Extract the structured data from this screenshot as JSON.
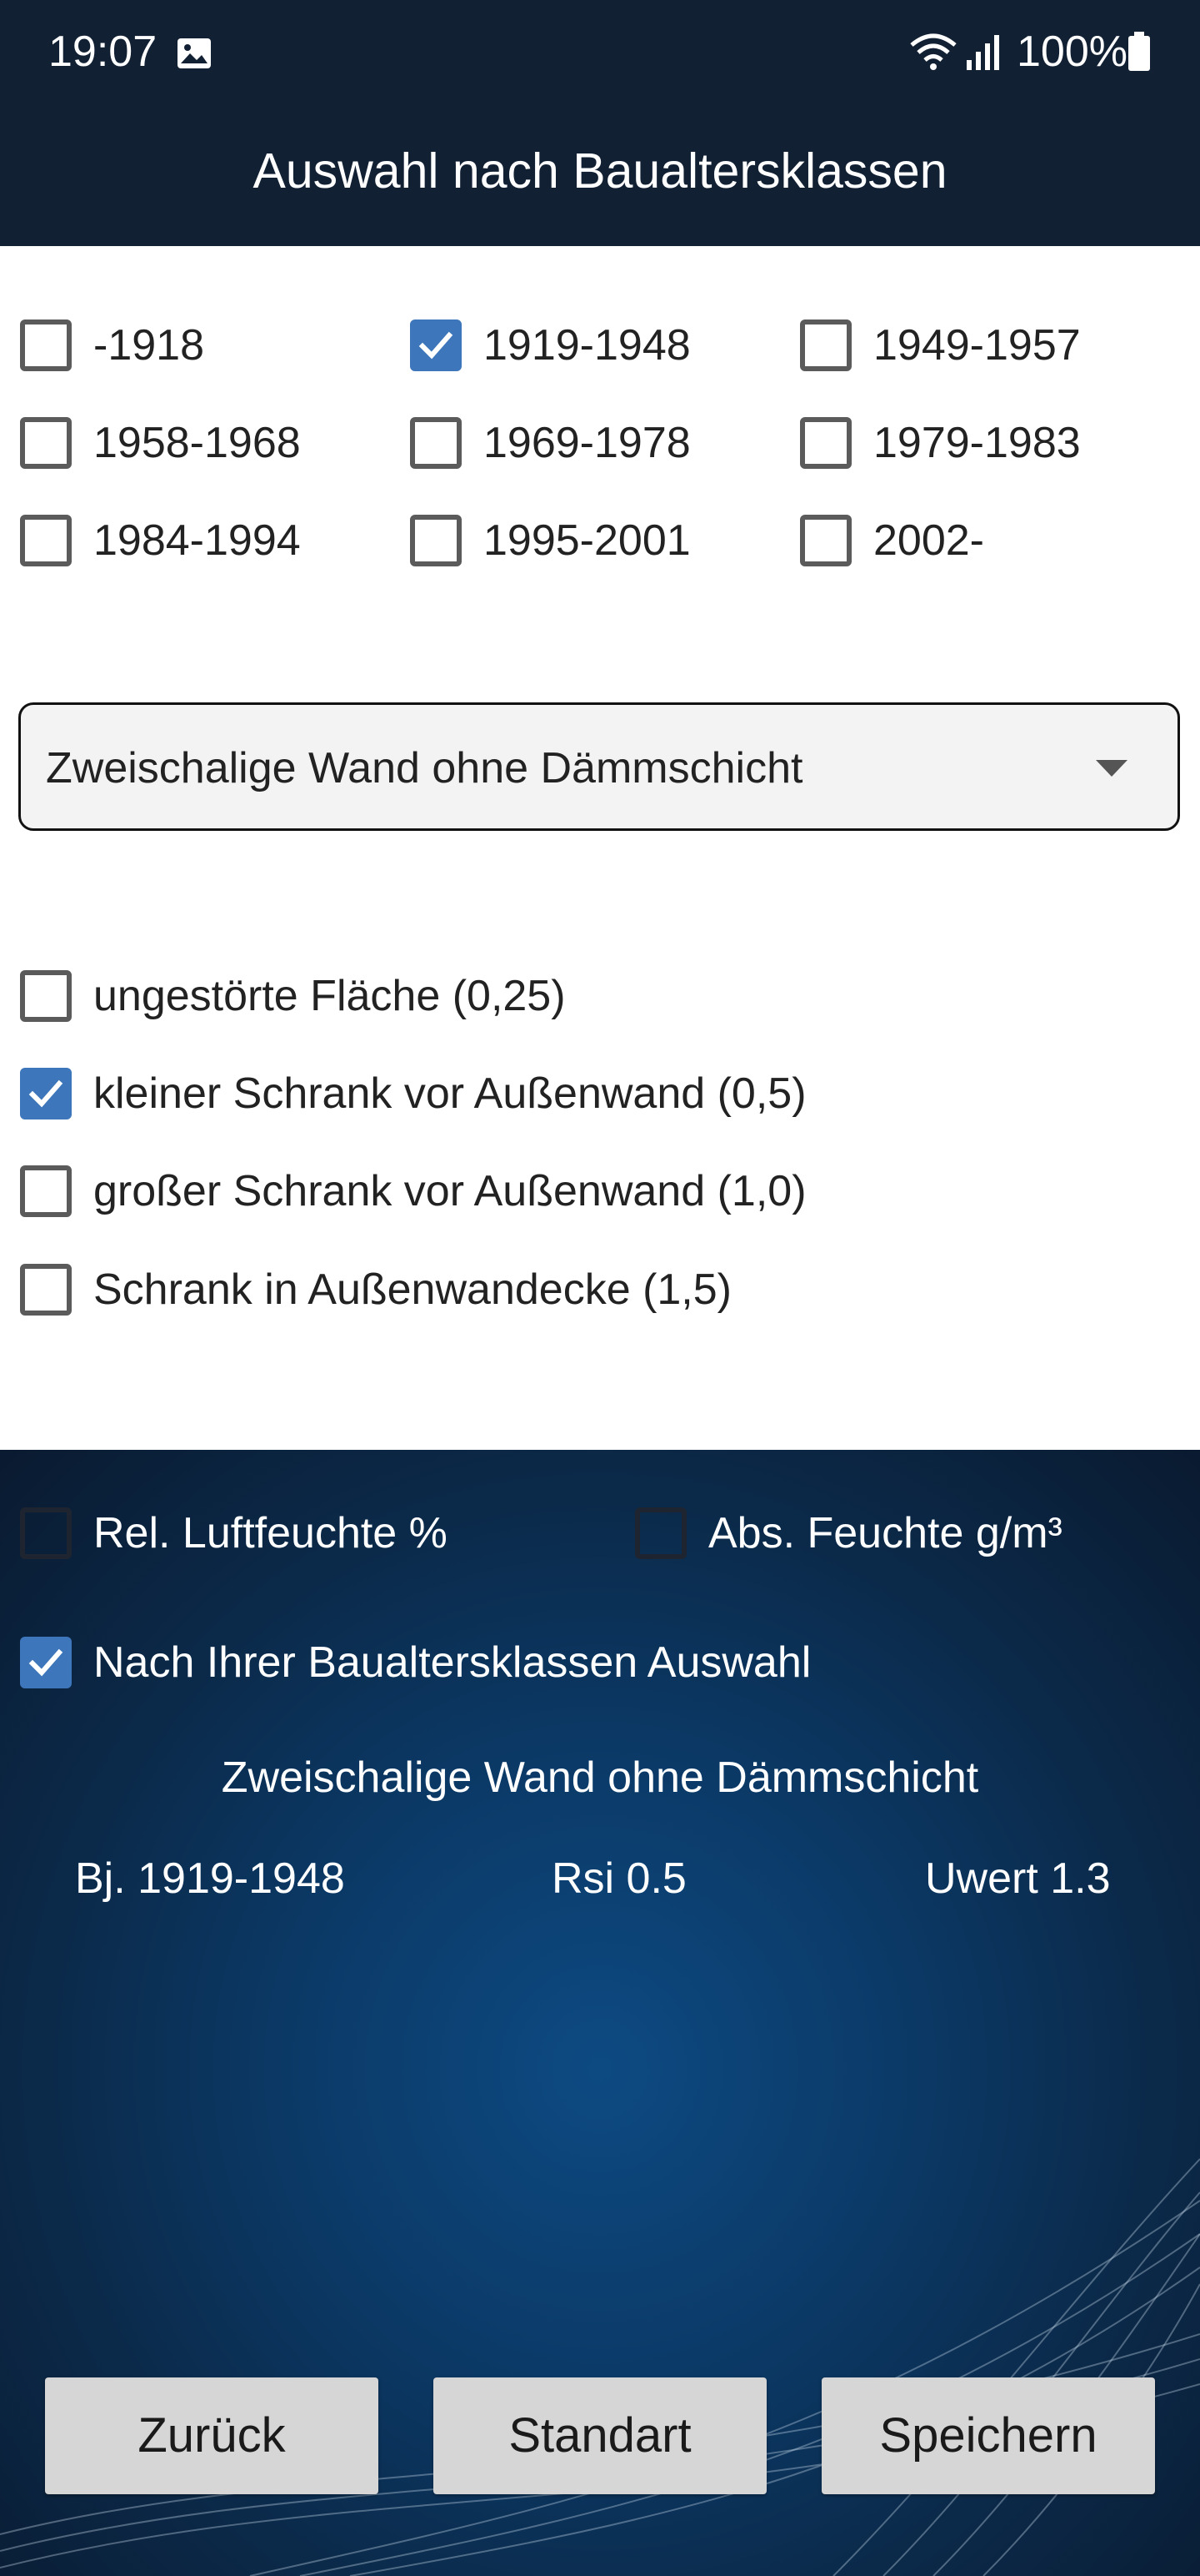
{
  "status_bar": {
    "time": "19:07",
    "battery": "100%"
  },
  "header": {
    "title": "Auswahl nach Baualtersklassen"
  },
  "year_classes": [
    {
      "label": "-1918",
      "checked": false
    },
    {
      "label": "1919-1948",
      "checked": true
    },
    {
      "label": "1949-1957",
      "checked": false
    },
    {
      "label": "1958-1968",
      "checked": false
    },
    {
      "label": "1969-1978",
      "checked": false
    },
    {
      "label": "1979-1983",
      "checked": false
    },
    {
      "label": "1984-1994",
      "checked": false
    },
    {
      "label": "1995-2001",
      "checked": false
    },
    {
      "label": "2002-",
      "checked": false
    }
  ],
  "wall_type": {
    "selected": "Zweischalige Wand ohne Dämmschicht"
  },
  "furniture_options": [
    {
      "label": "ungestörte Fläche (0,25)",
      "checked": false
    },
    {
      "label": "kleiner Schrank vor Außenwand (0,5)",
      "checked": true
    },
    {
      "label": "großer Schrank vor Außenwand (1,0)",
      "checked": false
    },
    {
      "label": "Schrank in Außenwandecke (1,5)",
      "checked": false
    }
  ],
  "humidity_options": {
    "relative": {
      "label": "Rel. Luftfeuchte %",
      "checked": false
    },
    "absolute": {
      "label": "Abs. Feuchte g/m³",
      "checked": false
    }
  },
  "selection_option": {
    "label": "Nach Ihrer Baualtersklassen Auswahl",
    "checked": true
  },
  "summary": {
    "wall": "Zweischalige Wand ohne Dämmschicht",
    "year": "Bj. 1919-1948",
    "rsi": "Rsi 0.5",
    "uwert": "Uwert 1.3"
  },
  "buttons": {
    "back": "Zurück",
    "default": "Standart",
    "save": "Speichern"
  },
  "colors": {
    "header_bg": "#122034",
    "checkbox_checked": "#3d76ba",
    "button_bg": "#d6d6d6"
  }
}
